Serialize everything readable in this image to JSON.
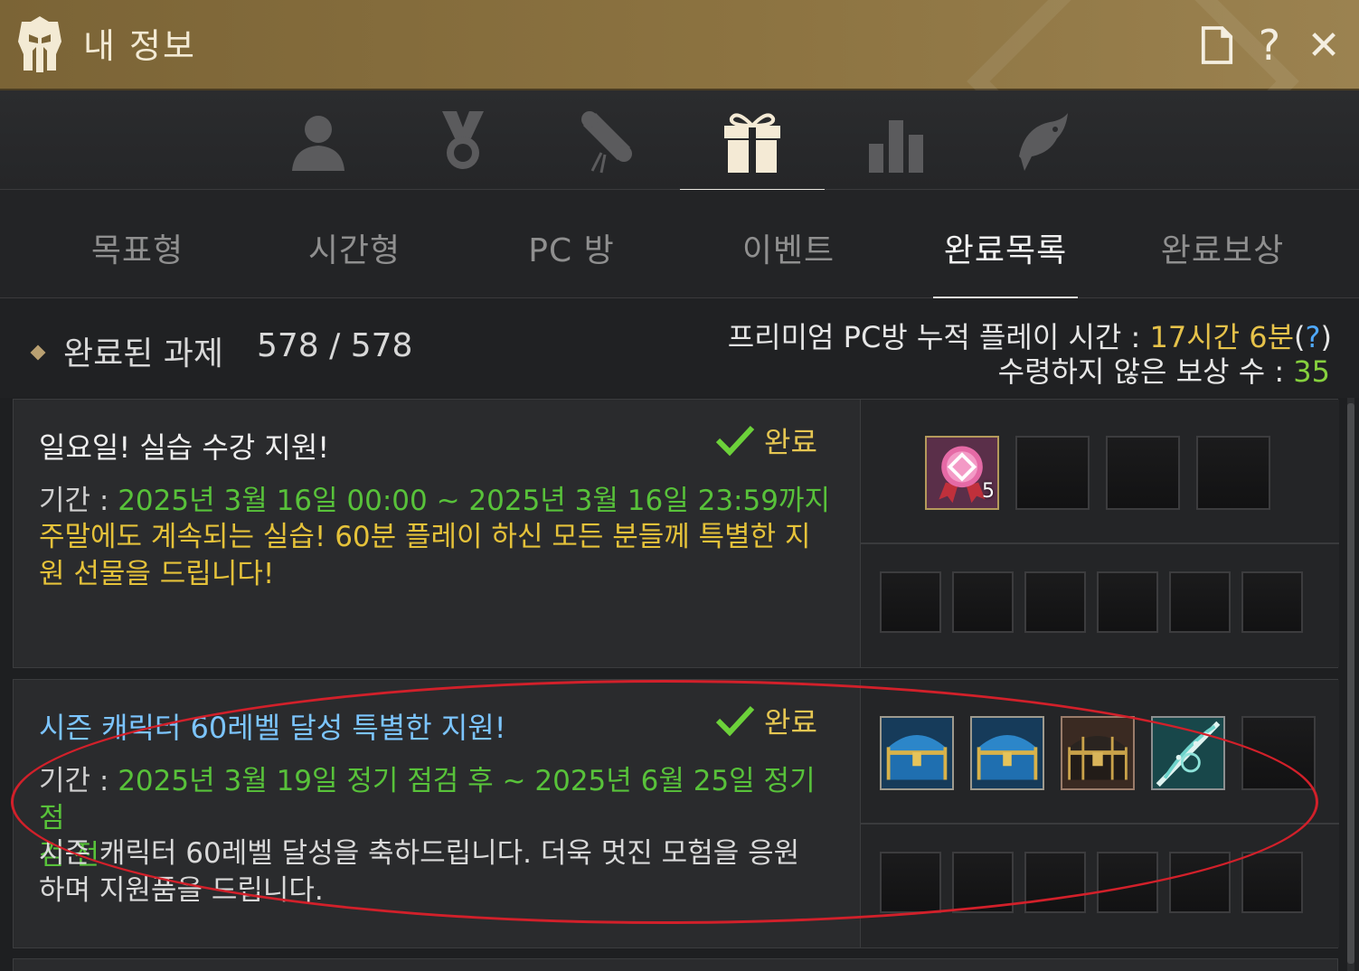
{
  "window": {
    "title": "내 정보",
    "help_glyph": "?",
    "close_glyph": "✕",
    "icons": [
      "helmet-logo",
      "document-icon",
      "help-icon",
      "close-icon"
    ]
  },
  "icon_tabs": [
    {
      "name": "profile-icon",
      "active": false
    },
    {
      "name": "medal-icon",
      "active": false
    },
    {
      "name": "scroll-icon",
      "active": false
    },
    {
      "name": "gift-icon",
      "active": true
    },
    {
      "name": "bar-chart-icon",
      "active": false
    },
    {
      "name": "fish-icon",
      "active": false
    }
  ],
  "tabs": [
    {
      "label": "목표형",
      "active": false
    },
    {
      "label": "시간형",
      "active": false
    },
    {
      "label": "PC 방",
      "active": false
    },
    {
      "label": "이벤트",
      "active": false
    },
    {
      "label": "완료목록",
      "active": true
    },
    {
      "label": "완료보상",
      "active": false
    }
  ],
  "summary": {
    "completed_label": "완료된 과제",
    "completed_count": "578 / 578",
    "pc_label": "프리미엄 PC방 누적 플레이 시간 : ",
    "pc_time": "17시간 6분",
    "pc_paren_open": "(",
    "pc_help": "?",
    "pc_paren_close": ")",
    "unclaimed_label": "수령하지 않은 보상 수 : ",
    "unclaimed_value": "35"
  },
  "tasks": [
    {
      "title": "일요일! 실습 수강 지원!",
      "status": "완료",
      "period_label": "기간 : ",
      "period": "2025년 3월 16일 00:00 ~ 2025년 3월 16일 23:59까지",
      "description_line1": "주말에도 계속되는 실습! 60분 플레이 하신 모든 분들께 특별한 지",
      "description_line2": "원 선물을 드립니다!",
      "rewards": [
        {
          "icon": "medal-badge-icon",
          "quantity": "5"
        }
      ]
    },
    {
      "title": "시즌 캐릭터 60레벨 달성 특별한 지원!",
      "status": "완료",
      "period_label": "기간 : ",
      "period_line1": "2025년 3월 19일 정기 점검 후 ~ 2025년 6월 25일 정기 점",
      "period_line2": "검 전",
      "description_line1": "시즌 캐릭터 60레벨 달성을 축하드립니다. 더욱 멋진 모험을 응원",
      "description_line2": "하며 지원품을 드립니다.",
      "rewards": [
        {
          "icon": "blue-chest-icon"
        },
        {
          "icon": "blue-chest-icon"
        },
        {
          "icon": "dark-chest-icon"
        },
        {
          "icon": "feather-scroll-icon"
        }
      ]
    }
  ],
  "colors": {
    "titlebar": "#8c7341",
    "period_green": "#58c23a",
    "desc_yellow": "#e5c23a",
    "status_yellow": "#e5c652",
    "check_green": "#6cd13a",
    "title_blue": "#7cc5ff",
    "highlight_red": "#d2202a"
  }
}
